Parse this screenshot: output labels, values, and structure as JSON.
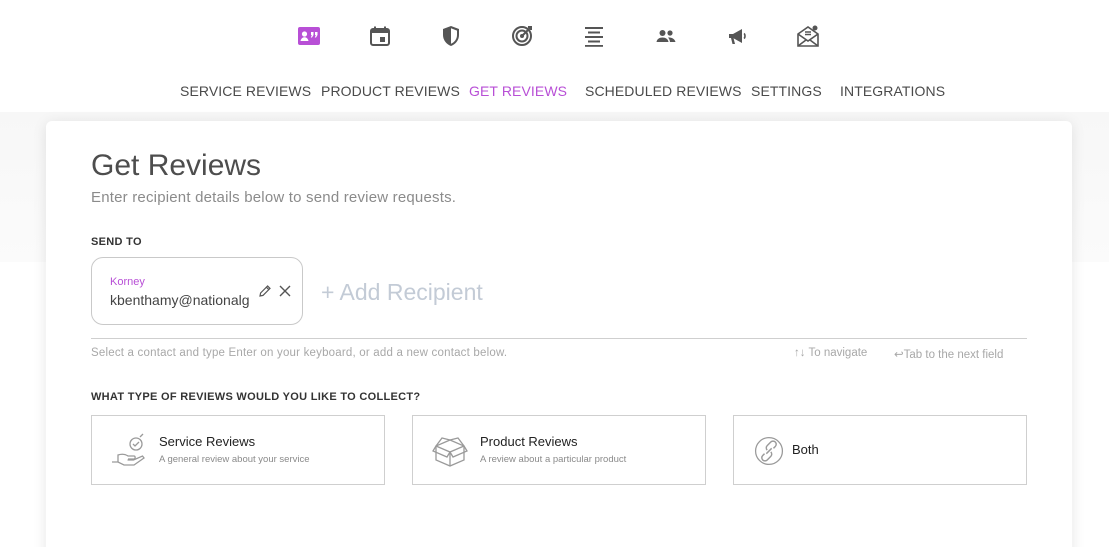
{
  "top_icons": [
    {
      "name": "reviews-card-icon",
      "active": true
    },
    {
      "name": "calendar-icon",
      "active": false
    },
    {
      "name": "shield-icon",
      "active": false
    },
    {
      "name": "target-icon",
      "active": false
    },
    {
      "name": "align-center-icon",
      "active": false
    },
    {
      "name": "people-icon",
      "active": false
    },
    {
      "name": "megaphone-icon",
      "active": false
    },
    {
      "name": "mail-icon",
      "active": false
    }
  ],
  "nav": {
    "tabs": [
      {
        "label": "SERVICE REVIEWS",
        "active": false
      },
      {
        "label": "PRODUCT REVIEWS",
        "active": false
      },
      {
        "label": "GET REVIEWS",
        "active": true
      },
      {
        "label": "SCHEDULED REVIEWS",
        "active": false
      },
      {
        "label": "SETTINGS",
        "active": false
      },
      {
        "label": "INTEGRATIONS",
        "active": false
      }
    ]
  },
  "page": {
    "title": "Get Reviews",
    "subtitle": "Enter recipient details below to send review requests."
  },
  "send_to": {
    "label": "SEND TO",
    "recipient": {
      "name": "Korney",
      "email": "kbenthamy@nationalgeographic.com"
    },
    "add_label": "+ Add Recipient",
    "help": "Select a contact and type Enter on your keyboard, or add a new contact below.",
    "hint_navigate": "↑↓ To navigate",
    "hint_tab": "↩Tab to the next field"
  },
  "review_type": {
    "label": "WHAT TYPE OF REVIEWS WOULD YOU LIKE TO COLLECT?",
    "options": [
      {
        "title": "Service Reviews",
        "desc": "A general review about your service"
      },
      {
        "title": "Product Reviews",
        "desc": "A review about a particular product"
      },
      {
        "title": "Both",
        "desc": ""
      }
    ]
  },
  "colors": {
    "accent": "#b84fd6",
    "text": "#4d4d4d",
    "muted": "#8b8b8b",
    "placeholder": "#c3cbd6"
  }
}
